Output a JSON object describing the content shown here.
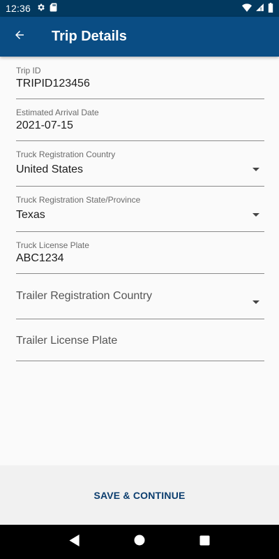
{
  "status_bar": {
    "time": "12:36",
    "icons": [
      "gear-icon",
      "sd-card-icon",
      "wifi-icon",
      "signal-icon",
      "battery-icon"
    ]
  },
  "app_bar": {
    "title": "Trip Details",
    "back_icon": "arrow-left-icon"
  },
  "form": {
    "trip_id": {
      "label": "Trip ID",
      "value": "TRIPID123456"
    },
    "arrival_date": {
      "label": "Estimated Arrival Date",
      "value": "2021-07-15"
    },
    "truck_country": {
      "label": "Truck Registration Country",
      "value": "United States"
    },
    "truck_state": {
      "label": "Truck Registration State/Province",
      "value": "Texas"
    },
    "truck_plate": {
      "label": "Truck License Plate",
      "value": "ABC1234"
    },
    "trailer_country": {
      "placeholder": "Trailer Registration Country"
    },
    "trailer_plate": {
      "placeholder": "Trailer License Plate"
    }
  },
  "actions": {
    "save_label": "SAVE & CONTINUE"
  },
  "colors": {
    "status_bar": "#02395f",
    "app_bar": "#0a4d84",
    "button_text": "#0b3d6e"
  }
}
